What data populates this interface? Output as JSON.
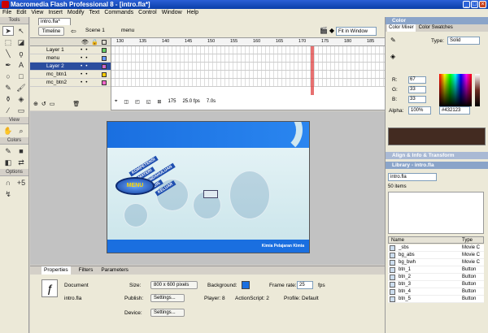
{
  "window": {
    "title": "Macromedia Flash Professional 8 - [intro.fla*]"
  },
  "menubar": [
    "File",
    "Edit",
    "View",
    "Insert",
    "Modify",
    "Text",
    "Commands",
    "Control",
    "Window",
    "Help"
  ],
  "tools": {
    "header": "Tools",
    "view_header": "View",
    "colors_header": "Colors",
    "options_header": "Options"
  },
  "doc_tab": "intro.fla*",
  "editbar": {
    "timeline_label": "Timeline",
    "scene_label": "Scene 1",
    "symbol_label": "menu",
    "zoom": "Fit in Window"
  },
  "timeline": {
    "frame_numbers": [
      "130",
      "135",
      "140",
      "145",
      "150",
      "155",
      "160",
      "165",
      "170",
      "175",
      "180",
      "185"
    ],
    "layers": [
      {
        "name": "Layer 1",
        "color": "#66cc66",
        "selected": false
      },
      {
        "name": "menu",
        "color": "#6699ff",
        "selected": false
      },
      {
        "name": "Layer 2",
        "color": "#cc66cc",
        "selected": true
      },
      {
        "name": "mc_btn1",
        "color": "#ffcc00",
        "selected": false
      },
      {
        "name": "mc_btn2",
        "color": "#ff66cc",
        "selected": false
      }
    ],
    "current_frame": "175",
    "fps": "25.0 fps",
    "elapsed": "7.0s"
  },
  "stage": {
    "menu_label": "MENU",
    "diagonal_labels": [
      "KOMPETENSI",
      "MATERI",
      "PENDAHULUAN",
      "KUIS",
      "KELUAR"
    ],
    "footer": "Kimia Pelajaran Kimia"
  },
  "properties": {
    "tabs": [
      "Properties",
      "Filters",
      "Parameters"
    ],
    "doc_type": "Document",
    "doc_name": "intro.fla",
    "size_label": "Size:",
    "size_value": "800 x 600 pixels",
    "background_label": "Background:",
    "background_color": "#1a6fe0",
    "framerate_label": "Frame rate:",
    "framerate_value": "25",
    "fps_unit": "fps",
    "publish_label": "Publish:",
    "settings_label": "Settings...",
    "player_label": "Player: 8",
    "actionscript_label": "ActionScript: 2",
    "profile_label": "Profile: Default",
    "device_label": "Device:",
    "device_settings": "Settings..."
  },
  "color_panel": {
    "header": "Color",
    "tabs": [
      "Color Mixer",
      "Color Swatches"
    ],
    "type_label": "Type:",
    "type_value": "Solid",
    "r_label": "R:",
    "r_value": "67",
    "g_label": "G:",
    "g_value": "33",
    "b_label": "B:",
    "b_value": "33",
    "alpha_label": "Alpha:",
    "alpha_value": "100%",
    "hex_value": "#432123",
    "swatch_color": "#432b21"
  },
  "align_panel": {
    "header": "Align & Info & Transform"
  },
  "library": {
    "header": "Library - intro.fla",
    "file": "intro.fla",
    "count": "50 items",
    "col_name": "Name",
    "col_type": "Type",
    "items": [
      {
        "name": "_sbs",
        "type": "Movie C"
      },
      {
        "name": "bg_abs",
        "type": "Movie C"
      },
      {
        "name": "bg_bwh",
        "type": "Movie C"
      },
      {
        "name": "btn_1",
        "type": "Button"
      },
      {
        "name": "btn_2",
        "type": "Button"
      },
      {
        "name": "btn_3",
        "type": "Button"
      },
      {
        "name": "btn_4",
        "type": "Button"
      },
      {
        "name": "btn_5",
        "type": "Button"
      }
    ]
  }
}
